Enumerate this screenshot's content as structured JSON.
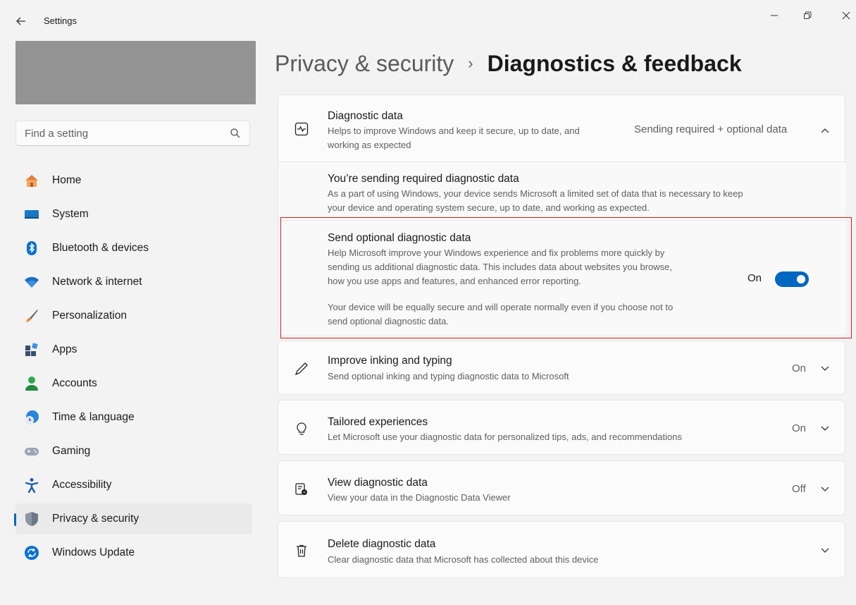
{
  "window": {
    "title": "Settings",
    "back_icon": "back-arrow-icon",
    "controls": [
      "minimize-icon",
      "maximize-icon",
      "close-icon"
    ]
  },
  "sidebar": {
    "search": {
      "placeholder": "Find a setting",
      "value": ""
    },
    "items": [
      {
        "label": "Home",
        "icon": "home-icon",
        "active": false
      },
      {
        "label": "System",
        "icon": "system-icon",
        "active": false
      },
      {
        "label": "Bluetooth & devices",
        "icon": "bluetooth-icon",
        "active": false
      },
      {
        "label": "Network & internet",
        "icon": "wifi-icon",
        "active": false
      },
      {
        "label": "Personalization",
        "icon": "brush-icon",
        "active": false
      },
      {
        "label": "Apps",
        "icon": "apps-icon",
        "active": false
      },
      {
        "label": "Accounts",
        "icon": "accounts-icon",
        "active": false
      },
      {
        "label": "Time & language",
        "icon": "globe-clock-icon",
        "active": false
      },
      {
        "label": "Gaming",
        "icon": "gamepad-icon",
        "active": false
      },
      {
        "label": "Accessibility",
        "icon": "accessibility-icon",
        "active": false
      },
      {
        "label": "Privacy & security",
        "icon": "shield-icon",
        "active": true
      },
      {
        "label": "Windows Update",
        "icon": "update-icon",
        "active": false
      }
    ]
  },
  "breadcrumb": {
    "parent": "Privacy & security",
    "separator": "›",
    "current": "Diagnostics & feedback"
  },
  "diagnostic_data": {
    "title": "Diagnostic data",
    "desc_line1": "Helps to improve Windows and keep it secure, up to date, and",
    "desc_line2": "working as expected",
    "value": "Sending required + optional data",
    "icon": "heartbeat-icon",
    "expanded": true,
    "required": {
      "title": "You’re sending required diagnostic data",
      "desc_line1": "As a part of using Windows, your device sends Microsoft a limited set of data that is necessary to keep",
      "desc_line2": "your device and operating system secure, up to date, and working as expected."
    },
    "optional": {
      "title": "Send optional diagnostic data",
      "desc_line1": "Help Microsoft improve your Windows experience and fix problems more quickly by",
      "desc_line2": "sending us additional diagnostic data. This includes data about websites you browse,",
      "desc_line3": "how you use apps and features, and enhanced error reporting.",
      "note_line1": "Your device will be equally secure and will operate normally even if you choose not to",
      "note_line2": "send optional diagnostic data.",
      "toggle_label": "On",
      "toggle_on": true
    }
  },
  "settings": [
    {
      "title": "Improve inking and typing",
      "desc": "Send optional inking and typing diagnostic data to Microsoft",
      "value": "On",
      "icon": "pen-icon"
    },
    {
      "title": "Tailored experiences",
      "desc": "Let Microsoft use your diagnostic data for personalized tips, ads, and recommendations",
      "value": "On",
      "icon": "lightbulb-icon"
    },
    {
      "title": "View diagnostic data",
      "desc": "View your data in the Diagnostic Data Viewer",
      "value": "Off",
      "icon": "data-viewer-icon"
    },
    {
      "title": "Delete diagnostic data",
      "desc": "Clear diagnostic data that Microsoft has collected about this device",
      "value": "",
      "icon": "trash-icon"
    }
  ],
  "colors": {
    "accent": "#0067c0",
    "highlight": "#e01b1b"
  }
}
